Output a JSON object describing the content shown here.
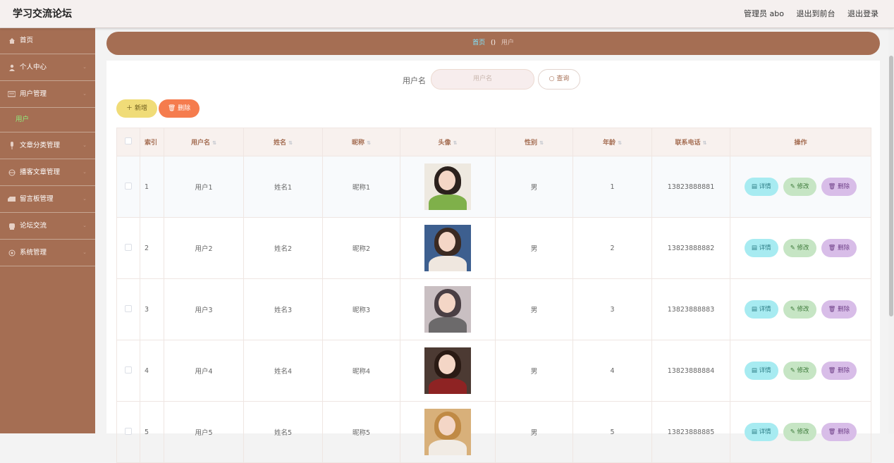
{
  "app": {
    "title": "学习交流论坛"
  },
  "topbar": {
    "admin_label": "管理员 abo",
    "front_label": "退出到前台",
    "logout_label": "退出登录"
  },
  "sidebar": {
    "items": [
      {
        "label": "首页",
        "icon": "home-icon",
        "arrow": ""
      },
      {
        "label": "个人中心",
        "icon": "user-icon",
        "arrow": "⌄"
      },
      {
        "label": "用户管理",
        "icon": "users-icon",
        "arrow": "⌄"
      },
      {
        "label": "文章分类管理",
        "icon": "mic-icon",
        "arrow": "⌄"
      },
      {
        "label": "播客文章管理",
        "icon": "globe-icon",
        "arrow": "⌄"
      },
      {
        "label": "留言板管理",
        "icon": "message-icon",
        "arrow": "⌄"
      },
      {
        "label": "论坛交流",
        "icon": "forum-icon",
        "arrow": "⌄"
      },
      {
        "label": "系统管理",
        "icon": "settings-icon",
        "arrow": "⌄"
      }
    ],
    "sub_item": "用户"
  },
  "breadcrumb": {
    "home": "首页",
    "sep": "()",
    "current": "用户"
  },
  "search": {
    "label": "用户名",
    "placeholder": "用户名",
    "button": "查询"
  },
  "actions": {
    "add": "新增",
    "delete": "删除"
  },
  "table": {
    "headers": [
      "索引",
      "用户名",
      "姓名",
      "昵称",
      "头像",
      "性别",
      "年龄",
      "联系电话",
      "操作"
    ],
    "ops": {
      "detail": "详情",
      "edit": "修改",
      "delete": "删除"
    },
    "rows": [
      {
        "idx": "1",
        "username": "用户1",
        "name": "姓名1",
        "nickname": "昵称1",
        "gender": "男",
        "age": "1",
        "phone": "13823888881"
      },
      {
        "idx": "2",
        "username": "用户2",
        "name": "姓名2",
        "nickname": "昵称2",
        "gender": "男",
        "age": "2",
        "phone": "13823888882"
      },
      {
        "idx": "3",
        "username": "用户3",
        "name": "姓名3",
        "nickname": "昵称3",
        "gender": "男",
        "age": "3",
        "phone": "13823888883"
      },
      {
        "idx": "4",
        "username": "用户4",
        "name": "姓名4",
        "nickname": "昵称4",
        "gender": "男",
        "age": "4",
        "phone": "13823888884"
      },
      {
        "idx": "5",
        "username": "用户5",
        "name": "姓名5",
        "nickname": "昵称5",
        "gender": "男",
        "age": "5",
        "phone": "13823888885"
      }
    ]
  },
  "colors": {
    "brand": "#a56e53",
    "accent_green": "#8ff07d",
    "breadcrumb_home": "#7fe6ff"
  }
}
